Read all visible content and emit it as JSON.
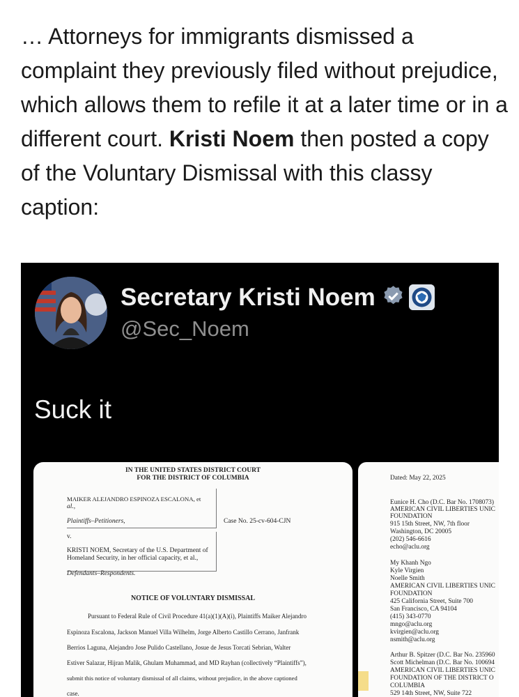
{
  "article": {
    "text_1": "… Attorneys for immigrants dismissed a complaint they previously filed without prejudice, which allows them to refile it at a later time or in a different court. ",
    "bold_name": "Kristi Noem",
    "text_2": " then posted a copy of the Voluntary Dismissal with this classy caption:"
  },
  "tweet": {
    "display_name": "Secretary Kristi Noem",
    "handle": "@Sec_Noem",
    "text": "Suck it",
    "icons": {
      "verified": "verified-check-icon",
      "affiliation": "dhs-seal-icon"
    }
  },
  "doc_page1": {
    "court_line1": "IN THE UNITED STATES DISTRICT COURT",
    "court_line2": "FOR THE DISTRICT OF COLUMBIA",
    "plaintiff_1": "MAIKER ALEJANDRO ESPINOZA ESCALONA, et",
    "plaintiff_2": "al.,",
    "plaintiff_role": "Plaintiffs–Petitioners,",
    "case_no": "Case No. 25-cv-604-CJN",
    "versus": "v.",
    "defendant_1": "KRISTI NOEM, Secretary of the U.S. Department of",
    "defendant_2": "Homeland Security, in her official capacity, et al.,",
    "defendant_role": "Defendants–Respondents.",
    "notice_title": "NOTICE OF VOLUNTARY DISMISSAL",
    "body": [
      "Pursuant to Federal Rule of Civil Procedure 41(a)(1)(A)(i), Plaintiffs Maiker Alejandro",
      "Espinoza Escalona, Jackson Manuel Villa Wilhelm, Jorge Alberto Castillo Cerrano, Janfrank",
      "Berrios Laguna, Alejandro Jose Pulido Castellano, Josue de Jesus Torcati Sebrian, Walter",
      "Estiver Salazar, Hijran Malik, Ghulam Muhammad, and MD Rayhan (collectively “Plaintiffs”),",
      "submit this notice of voluntary dismissal of all claims, without prejudice, in the above captioned",
      "case."
    ]
  },
  "doc_page2": {
    "dated": "Dated: May 22, 2025",
    "lines": [
      "Eunice H. Cho (D.C. Bar No. 1708073)",
      "AMERICAN CIVIL LIBERTIES UNIC",
      "FOUNDATION",
      "915 15th Street, NW, 7th floor",
      "Washington, DC 20005",
      "(202) 546-6616",
      "echo@aclu.org",
      "",
      "My Khanh Ngo",
      "Kyle Virgien",
      "Noelle Smith",
      "AMERICAN CIVIL LIBERTIES UNIC",
      "FOUNDATION",
      "425 California Street, Suite 700",
      "San Francisco, CA 94104",
      "(415) 343-0770",
      "mngo@aclu.org",
      "kvirgien@aclu.org",
      "nsmith@aclu.org",
      "",
      "Arthur B. Spitzer (D.C. Bar No. 235960",
      "Scott Michelman (D.C. Bar No. 100694",
      "AMERICAN CIVIL LIBERTIES UNIC",
      "FOUNDATION OF THE DISTRICT O",
      "COLUMBIA",
      "529 14th Street, NW, Suite 722"
    ]
  }
}
